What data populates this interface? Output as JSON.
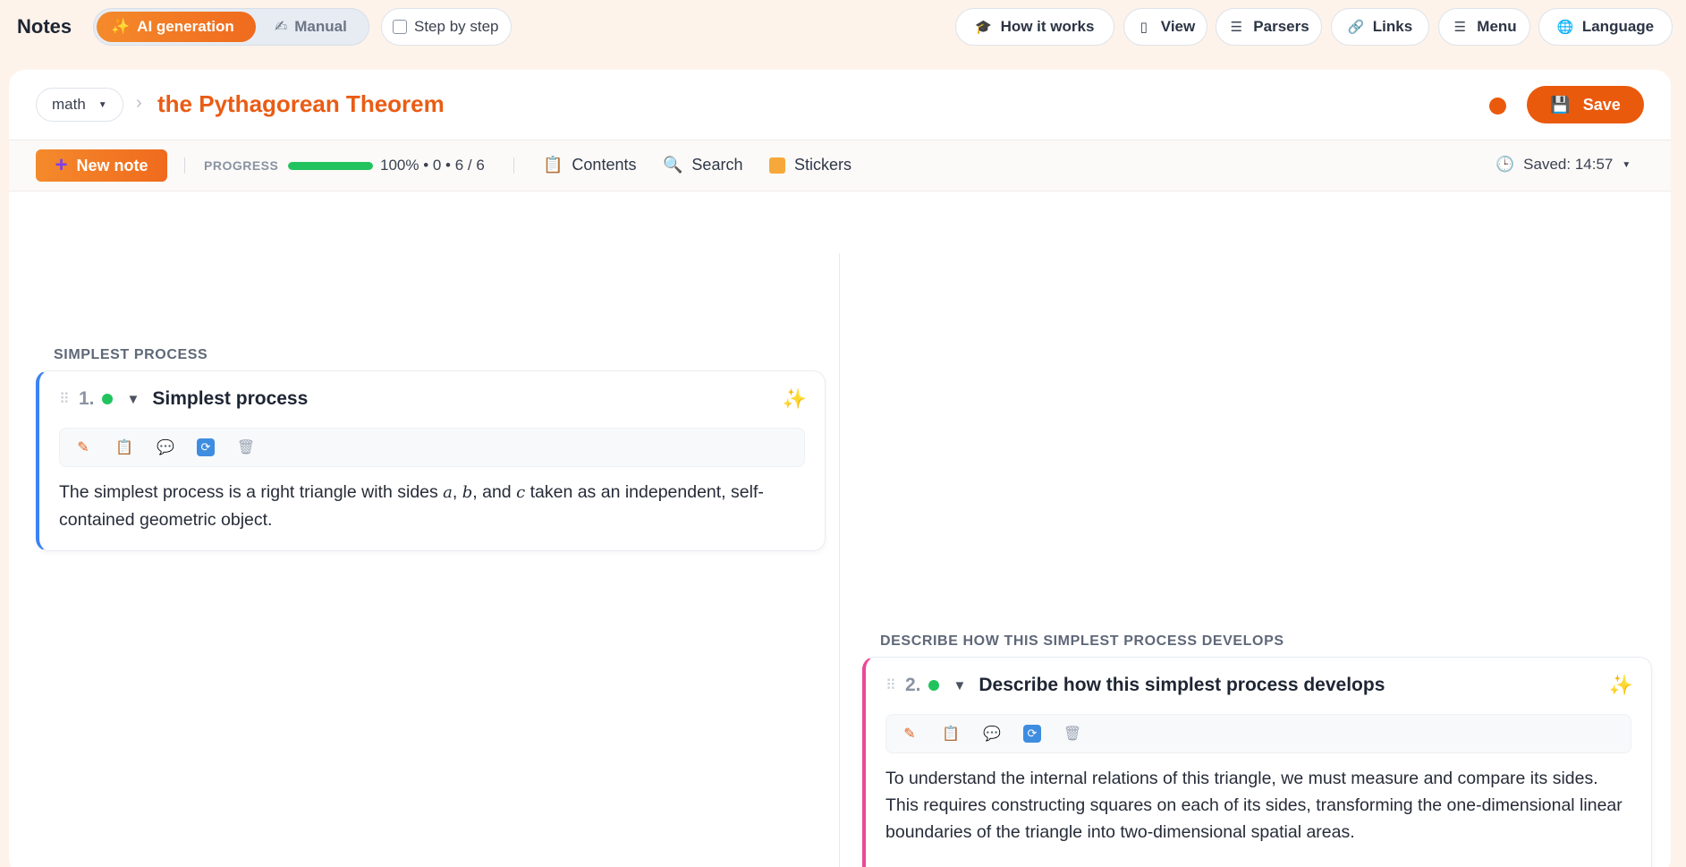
{
  "app": {
    "title": "Notes"
  },
  "mode": {
    "ai_label": "AI generation",
    "manual_label": "Manual",
    "step_label": "Step by step"
  },
  "nav": {
    "how_it_works": "How it works",
    "view": "View",
    "parsers": "Parsers",
    "links": "Links",
    "menu": "Menu",
    "language": "Language"
  },
  "breadcrumb": {
    "subject": "math",
    "title": "the Pythagorean Theorem"
  },
  "save": {
    "label": "Save",
    "status_color": "#ea5a0c"
  },
  "toolbar": {
    "new_note": "New note",
    "progress_label": "PROGRESS",
    "progress_value": 1.0,
    "progress_text": "100% • 0 • 6 / 6",
    "contents": "Contents",
    "search": "Search",
    "stickers": "Stickers",
    "saved": "Saved: 14:57"
  },
  "notes": [
    {
      "section": "SIMPLEST PROCESS",
      "number": "1.",
      "title": "Simplest process",
      "accent": "#3b82f6",
      "body": {
        "pre": "The simplest process is a right triangle with sides ",
        "var_a": "a",
        "sep1": ", ",
        "var_b": "b",
        "sep2": ", and ",
        "var_c": "c",
        "post": " taken as an independent, self-contained geometric object."
      }
    },
    {
      "section": "DESCRIBE HOW THIS SIMPLEST PROCESS DEVELOPS",
      "number": "2.",
      "title": "Describe how this simplest process develops",
      "accent": "#ec4899",
      "body_text": "To understand the internal relations of this triangle, we must measure and compare its sides. This requires constructing squares on each of its sides, transforming the one-dimensional linear boundaries of the triangle into two-dimensional spatial areas."
    }
  ],
  "colors": {
    "brand": "#ea5a0c",
    "progress": "#22c35e",
    "background": "#fdf3ea"
  }
}
